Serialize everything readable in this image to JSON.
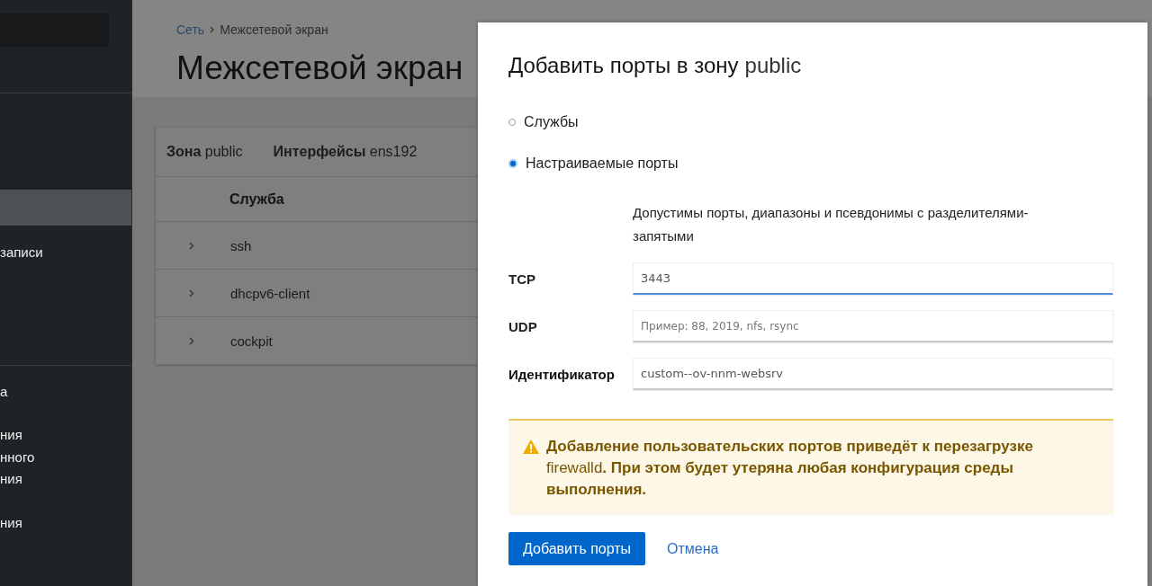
{
  "sidebar": {
    "items": [
      {
        "selected": true
      },
      {
        "label": "записи",
        "selected": false
      },
      {
        "label": "а",
        "selected": false
      },
      {
        "label": "ния\nнного\nния",
        "selected": false
      },
      {
        "label": "ния",
        "selected": false
      }
    ]
  },
  "breadcrumb": [
    {
      "label": "Сеть",
      "kind": "link"
    },
    {
      "label": "Межсетевой экран",
      "kind": "current"
    }
  ],
  "page_title": "Межсетевой экран",
  "zone_card": {
    "zone": "**Зона** public",
    "interfaces": "**Интерфейсы** ens192",
    "columns": [
      "Служба"
    ],
    "rows": [
      {
        "service": "ssh",
        "expanded": false
      },
      {
        "service": "dhcpv6-client",
        "expanded": false
      },
      {
        "service": "cockpit",
        "expanded": false
      }
    ]
  },
  "dialog": {
    "title": "Добавить порты в зону",
    "zone": "public",
    "options": [
      {
        "label": "Службы",
        "selected": false
      },
      {
        "label": "Настраиваемые порты",
        "selected": true
      }
    ],
    "helper": "Допустимы порты, диапазоны и псевдонимы с разделителями-запятыми",
    "fields": [
      {
        "label": "TCP",
        "value": "3443",
        "focused": true
      },
      {
        "label": "UDP",
        "placeholder": "Пример: 88, 2019, nfs, rsync",
        "focused": false
      },
      {
        "label": "Идентификатор",
        "value": "custom--ov-nnm-websrv",
        "focused": false
      }
    ],
    "warning": "**Добавление пользовательских портов приведёт к перезагрузке** firewalld**. При этом будет утеряна любая конфигурация среды выполнения.**",
    "buttons": [
      {
        "label": "Добавить порты",
        "kind": "primary"
      },
      {
        "label": "Отмена",
        "kind": "link"
      }
    ]
  }
}
